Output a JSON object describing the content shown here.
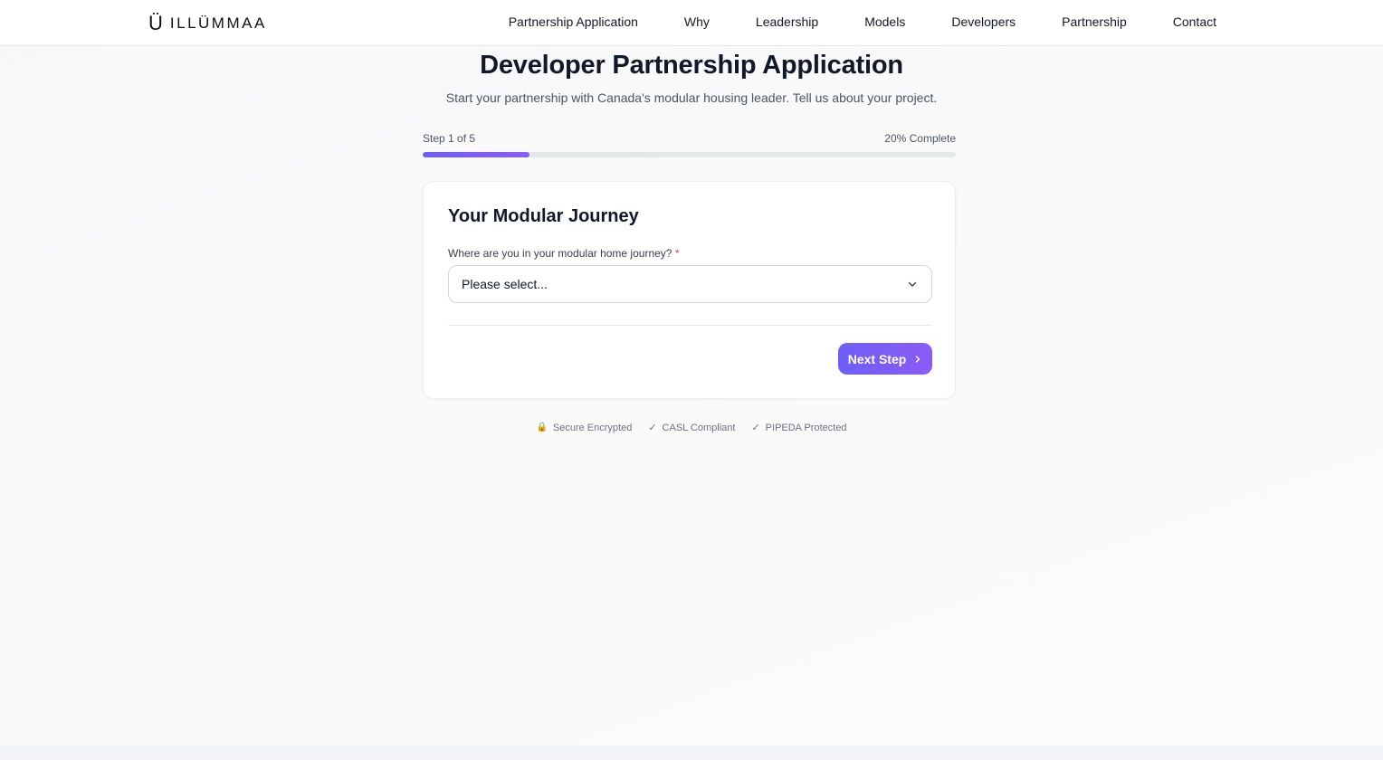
{
  "brand": {
    "mark": "Ü",
    "name": "ILLÜMMAA"
  },
  "nav": {
    "items": [
      {
        "label": "Partnership Application"
      },
      {
        "label": "Why"
      },
      {
        "label": "Leadership"
      },
      {
        "label": "Models"
      },
      {
        "label": "Developers"
      },
      {
        "label": "Partnership"
      },
      {
        "label": "Contact"
      }
    ]
  },
  "hero": {
    "title": "Developer Partnership Application",
    "subtitle": "Start your partnership with Canada's modular housing leader. Tell us about your project."
  },
  "progress": {
    "step_label": "Step 1 of 5",
    "percent_label": "20% Complete",
    "fraction": 0.2,
    "accent": "#6d5ef5"
  },
  "form": {
    "section_title": "Your Modular Journey",
    "journey_label": "Where are you in your modular home journey?",
    "required_mark": "*",
    "journey_value": "Please select...",
    "next_label": "Next Step"
  },
  "trust": {
    "secure": "Secure Encrypted",
    "casl": "CASL Compliant",
    "pipeda": "PIPEDA Protected",
    "check_glyph": "✓",
    "lock_glyph": "🔒"
  },
  "icons": {
    "logo": "logo-mark-icon",
    "select_chevron": "chevron-down-icon",
    "next_chevron": "chevron-right-icon",
    "secure": "lock-icon",
    "check": "check-icon"
  }
}
